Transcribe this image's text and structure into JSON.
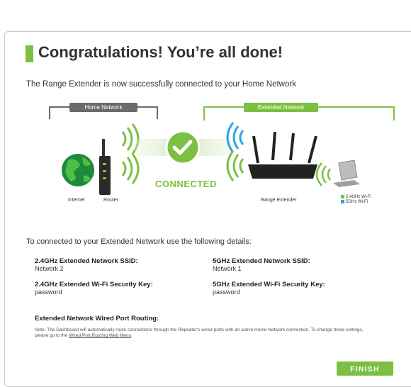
{
  "header": {
    "title": "Congratulations! You’re all done!"
  },
  "intro": "The Range Extender is now successfully connected to your Home Network",
  "diagram": {
    "home_network_label": "Home Network",
    "extended_network_label": "Extended Network",
    "internet_label": "Internet",
    "router_label": "Router",
    "range_extender_label": "Range Extender",
    "status_text": "CONNECTED",
    "legend": [
      {
        "label": "2.4GHz Wi-Fi",
        "color": "#7cc043"
      },
      {
        "label": "5GHz Wi-Fi",
        "color": "#2aa7e0"
      }
    ]
  },
  "details": {
    "intro": "To connected to your Extended Network use the following details:",
    "ssid_24_label": "2.4GHz Extended Network SSID:",
    "ssid_24_value": "Network 2",
    "key_24_label": "2.4GHz Extended Wi-Fi Security Key:",
    "key_24_value": "password",
    "ssid_5_label": "5GHz Extended Network SSID:",
    "ssid_5_value": "Network 1",
    "key_5_label": "5GHz Extended Wi-Fi Security Key:",
    "key_5_value": "password",
    "wired_label": "Extended Network Wired Port Routing:",
    "note_text": "Note: The Dashboard will automatically route connections through the Repeater's wired ports with an active Home Network connection. To change these settings, please go to the",
    "note_link": "Wired Port Routing Web Menu",
    "note_end": "."
  },
  "footer": {
    "finish_label": "FINISH"
  },
  "colors": {
    "accent": "#7cc043",
    "home": "#6b6b6b",
    "wifi5": "#2aa7e0"
  }
}
